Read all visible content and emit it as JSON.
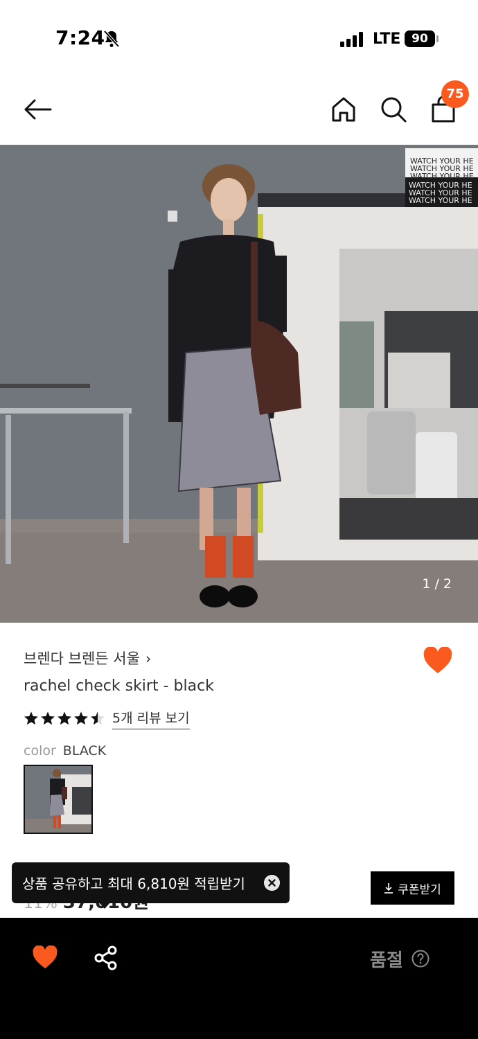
{
  "status_bar": {
    "time": "7:24",
    "network": "LTE",
    "battery": "90",
    "icons": [
      "bell-slash-icon",
      "signal-icon"
    ]
  },
  "header": {
    "cart_count": "75",
    "icons": [
      "back-arrow-icon",
      "home-icon",
      "search-icon",
      "shopping-bag-icon"
    ]
  },
  "gallery": {
    "counter": "1 / 2",
    "sign_lines": [
      "WATCH YOUR HE",
      "WATCH YOUR HE",
      "WATCH YOUR HE",
      "WATCH YOUR HE",
      "WATCH YOUR HE",
      "WATCH YOUR HE"
    ]
  },
  "product": {
    "brand": "브렌다 브렌든 서울",
    "name": "rachel check skirt - black",
    "rating": 4.5,
    "review_link": "5개 리뷰 보기",
    "color_label": "color",
    "color_value": "BLACK",
    "price_discount_partial": "11%",
    "price_partial": "37,010원"
  },
  "toast": {
    "text": "상품 공유하고 최대 6,810원 적립받기"
  },
  "coupon": {
    "label": "쿠폰받기"
  },
  "bottom_bar": {
    "status_label": "품절"
  },
  "colors": {
    "accent": "#fa5a1e",
    "bottom_bar": "#000000",
    "soldout_text": "#8a8a8a"
  }
}
